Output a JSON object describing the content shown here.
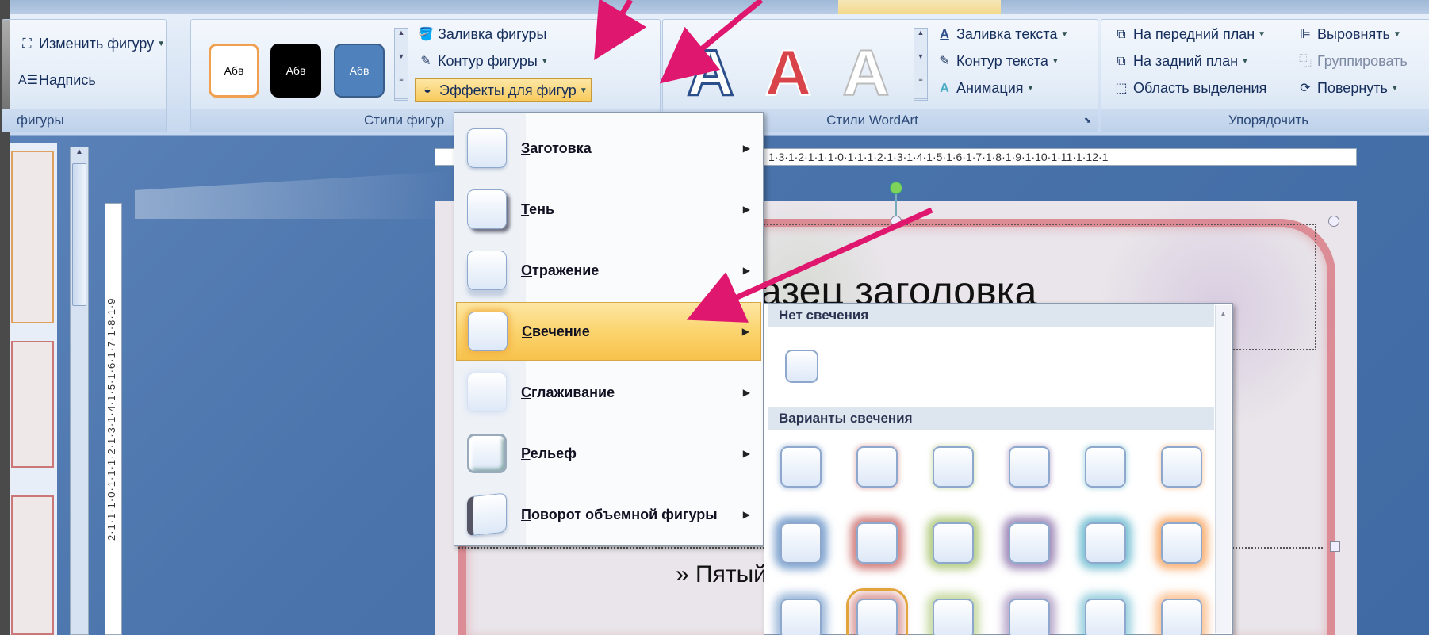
{
  "ribbon": {
    "shapes_group": {
      "change_shape": "Изменить фигуру",
      "textbox": "Надпись",
      "label": "фигуры"
    },
    "shape_styles_group": {
      "thumbs": [
        "Абв",
        "Абв",
        "Абв"
      ],
      "fill": "Заливка фигуры",
      "outline": "Контур фигуры",
      "effects": "Эффекты для фигур",
      "label": "Стили фигур"
    },
    "wordart_group": {
      "letters": [
        "A",
        "A",
        "A"
      ],
      "text_fill": "Заливка текста",
      "text_outline": "Контур текста",
      "animation": "Анимация",
      "label": "Стили WordArt"
    },
    "arrange_group": {
      "bring_front": "На передний план",
      "send_back": "На задний план",
      "selection_pane": "Область выделения",
      "align": "Выровнять",
      "group": "Группировать",
      "rotate": "Повернуть",
      "label": "Упорядочить"
    }
  },
  "effects_menu": {
    "items": [
      {
        "label": "Заготовка"
      },
      {
        "label": "Тень"
      },
      {
        "label": "Отражение"
      },
      {
        "label": "Свечение"
      },
      {
        "label": "Сглаживание"
      },
      {
        "label": "Рельеф"
      },
      {
        "label": "Поворот объемной фигуры"
      }
    ]
  },
  "glow_menu": {
    "no_glow_header": "Нет свечения",
    "variants_header": "Варианты свечения",
    "glow_colors": [
      "#4f81bd",
      "#c0504d",
      "#9bbb59",
      "#8064a2",
      "#4bacc6",
      "#f79646"
    ]
  },
  "slide": {
    "title": "азец заголовка",
    "bullet": "» Пятый"
  },
  "rulers": {
    "horizontal": "1·3·1·2·1·1·1·0·1·1·1·2·1·3·1·4·1·5·1·6·1·7·1·8·1·9·1·10·1·11·1·12·1",
    "vertical": "2·1·1·1·0·1·1·1·2·1·3·1·4·1·5·1·6·1·7·1·8·1·9"
  },
  "colors": {
    "accent_arrow": "#e0176e",
    "menu_highlight": "#fbd46e"
  }
}
